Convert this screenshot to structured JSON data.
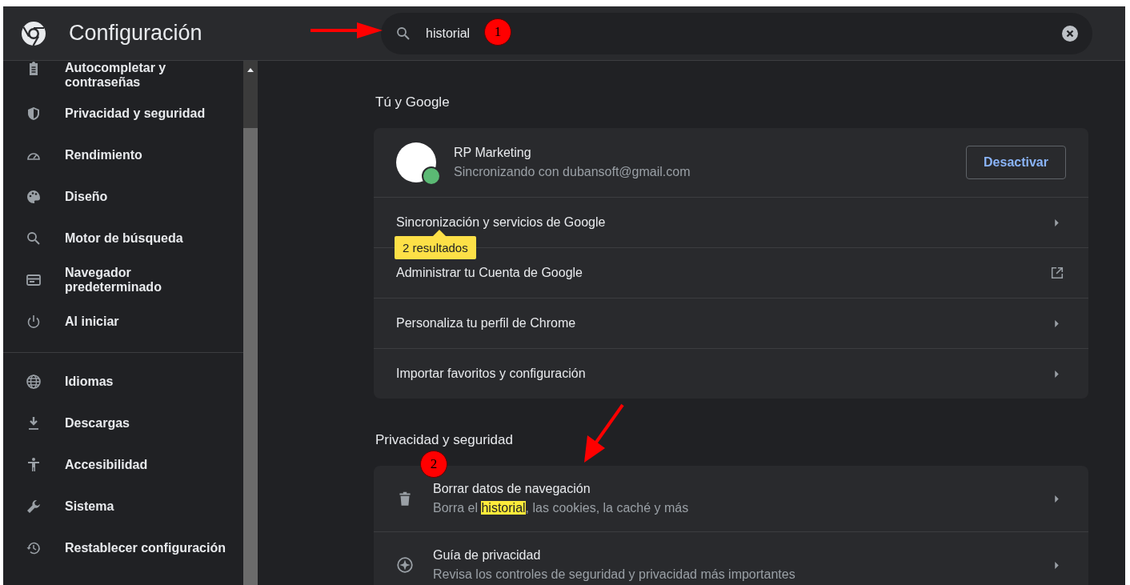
{
  "header": {
    "title": "Configuración",
    "search": {
      "value": "historial"
    }
  },
  "sidebar": {
    "groups": [
      [
        {
          "label": "Autocompletar y contraseñas"
        },
        {
          "label": "Privacidad y seguridad"
        },
        {
          "label": "Rendimiento"
        },
        {
          "label": "Diseño"
        },
        {
          "label": "Motor de búsqueda"
        },
        {
          "label": "Navegador predeterminado"
        },
        {
          "label": "Al iniciar"
        }
      ],
      [
        {
          "label": "Idiomas"
        },
        {
          "label": "Descargas"
        },
        {
          "label": "Accesibilidad"
        },
        {
          "label": "Sistema"
        },
        {
          "label": "Restablecer configuración"
        }
      ]
    ]
  },
  "sections": [
    {
      "title": "Tú y Google",
      "rows": [
        {
          "kind": "account",
          "name": "RP Marketing",
          "subtitle": "Sincronizando con dubansoft@gmail.com",
          "button": "Desactivar"
        },
        {
          "kind": "link",
          "label": "Sincronización y servicios de Google"
        },
        {
          "kind": "external",
          "label": "Administrar tu Cuenta de Google"
        },
        {
          "kind": "link",
          "label": "Personaliza tu perfil de Chrome"
        },
        {
          "kind": "link",
          "label": "Importar favoritos y configuración"
        }
      ]
    },
    {
      "title": "Privacidad y seguridad",
      "rows": [
        {
          "kind": "detail",
          "label": "Borrar datos de navegación",
          "subtitle": {
            "before": "Borra el ",
            "match": "historial",
            "after": ", las cookies, la caché y más"
          }
        },
        {
          "kind": "detail",
          "label": "Guía de privacidad",
          "subtitle": {
            "before": "Revisa los controles de seguridad y privacidad más importantes"
          }
        }
      ]
    }
  ],
  "tooltip": {
    "text": "2 resultados"
  },
  "annotations": [
    {
      "kind": "arrow"
    },
    {
      "kind": "marker",
      "text": "1"
    },
    {
      "kind": "arrow"
    },
    {
      "kind": "marker",
      "text": "2"
    }
  ]
}
